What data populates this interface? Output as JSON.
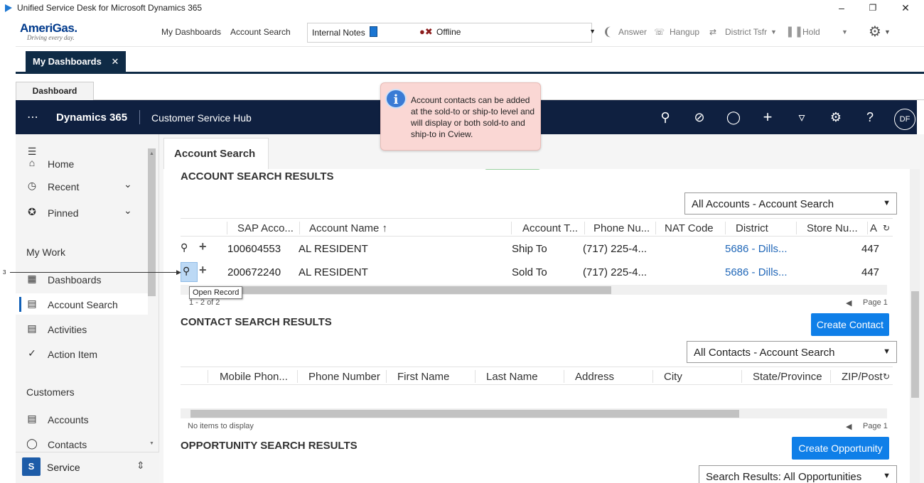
{
  "window": {
    "title": "Unified Service Desk for Microsoft Dynamics 365"
  },
  "usd": {
    "brand": "AmeriGas.",
    "tagline": "Driving every day.",
    "links": [
      "My Dashboards",
      "Account Search"
    ],
    "notes_label": "Internal Notes",
    "status": "Offline",
    "phone": {
      "answer": "Answer",
      "hangup": "Hangup",
      "transfer": "District Tsfr",
      "hold": "Hold"
    }
  },
  "session_tab": "My Dashboards",
  "dashboard_tab": "Dashboard",
  "nav": {
    "app": "Dynamics 365",
    "hub": "Customer Service Hub",
    "avatar": "DF"
  },
  "callout": "Account contacts can be added at the sold-to or ship-to level and will display or both sold-to and ship-to in Cview.",
  "sidebar": {
    "home": "Home",
    "recent": "Recent",
    "pinned": "Pinned",
    "group_mywork": "My Work",
    "mywork": [
      "Dashboards",
      "Account Search",
      "Activities",
      "Action Item"
    ],
    "group_customers": "Customers",
    "customers": [
      "Accounts",
      "Contacts"
    ],
    "area": {
      "letter": "S",
      "label": "Service"
    }
  },
  "main": {
    "tab": "Account Search",
    "accounts": {
      "heading": "ACCOUNT SEARCH RESULTS",
      "view": "All Accounts - Account Search",
      "columns": [
        "SAP Acco...",
        "Account Name ↑",
        "Account T...",
        "Phone Nu...",
        "NAT Code",
        "District",
        "Store Nu...",
        "A"
      ],
      "rows": [
        {
          "sap": "100604553",
          "name": "AL RESIDENT",
          "type": "Ship To",
          "phone": "(717) 225-4...",
          "district": "5686 - Dills...",
          "store": "447"
        },
        {
          "sap": "200672240",
          "name": "AL RESIDENT",
          "type": "Sold To",
          "phone": "(717) 225-4...",
          "district": "5686 - Dills...",
          "store": "447"
        }
      ],
      "count": "1 - 2 of 2",
      "page": "Page 1"
    },
    "contacts": {
      "heading": "CONTACT SEARCH RESULTS",
      "create": "Create Contact",
      "view": "All Contacts - Account Search",
      "columns": [
        "Mobile Phon...",
        "Phone Number",
        "First Name",
        "Last Name",
        "Address",
        "City",
        "State/Province",
        "ZIP/Post"
      ],
      "empty": "No items to display",
      "page": "Page 1"
    },
    "opportunities": {
      "heading": "OPPORTUNITY SEARCH RESULTS",
      "create": "Create Opportunity",
      "view": "Search Results: All Opportunities"
    }
  },
  "tooltip": "Open Record",
  "step": "3"
}
